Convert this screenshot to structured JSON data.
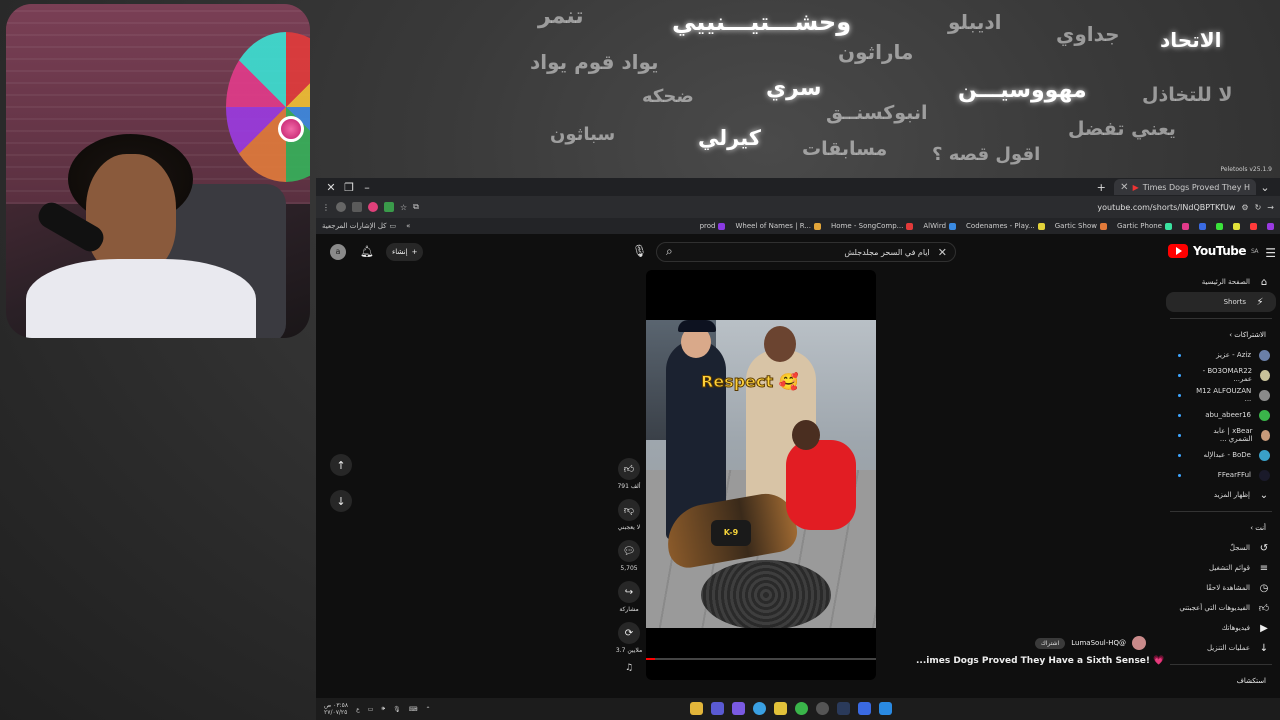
{
  "chalkboard": {
    "words": [
      {
        "text": "تنمر",
        "bright": false
      },
      {
        "text": "وحشـــتيـــنييي",
        "bright": true
      },
      {
        "text": "اديبلو",
        "bright": false
      },
      {
        "text": "جداوي",
        "bright": false
      },
      {
        "text": "الاتحاد",
        "bright": true
      },
      {
        "text": "يواد قوم يواد",
        "bright": false
      },
      {
        "text": "ماراثون",
        "bright": false
      },
      {
        "text": "سري",
        "bright": true
      },
      {
        "text": "ضحكه",
        "bright": false
      },
      {
        "text": "مهووسيـــن",
        "bright": true
      },
      {
        "text": "لا للتخاذل",
        "bright": false
      },
      {
        "text": "انبوكسنــق",
        "bright": false
      },
      {
        "text": "يعني تفضل",
        "bright": false
      },
      {
        "text": "سباثون",
        "bright": false
      },
      {
        "text": "كيرلي",
        "bright": true
      },
      {
        "text": "مسابقات",
        "bright": false
      },
      {
        "text": "اقول قصه ؟",
        "bright": false
      }
    ]
  },
  "browser": {
    "tab_title": "Times Dogs Proved They H",
    "url": "youtube.com/shorts/INdQBPTKfUw",
    "extension_label": "Peletools v25.1.9",
    "bookmarks": [
      "prod",
      "Wheel of Names | R...",
      "Home - SongComp...",
      "AlWird",
      "Codenames - Play...",
      "Gartic Show",
      "Gartic Phone"
    ],
    "bookmarks_all": "كل الإشارات المرجعية"
  },
  "youtube": {
    "logo_text": "YouTube",
    "logo_country": "SA",
    "search_query": "ايام في السحر مجلدجلش",
    "create_label": "إنشاء",
    "avatar_letter": "a",
    "sidebar": {
      "home": "الصفحة الرئيسية",
      "shorts": "Shorts",
      "subscriptions_header": "الاشتراكات",
      "subscriptions": [
        {
          "name": "Aziz - عزيز",
          "color": "#6a7fa8"
        },
        {
          "name": "BO3OMAR22 - عمر...",
          "color": "#c8c29a"
        },
        {
          "name": "M12 ALFOUZAN ...",
          "color": "#8a8a8a"
        },
        {
          "name": "abu_abeer16",
          "color": "#3ab54a"
        },
        {
          "name": "xBear | عابد الشمري ...",
          "color": "#c89a7a"
        },
        {
          "name": "BoDe - عبدالإله",
          "color": "#3aa0c8"
        },
        {
          "name": "FFearFFul",
          "color": "#1a1a2a"
        }
      ],
      "show_more": "إظهار المزيد",
      "you_header": "أنت",
      "you_items": [
        {
          "label": "السجلّ",
          "icon": "history-icon"
        },
        {
          "label": "قوائم التشغيل",
          "icon": "playlist-icon"
        },
        {
          "label": "المشاهدة لاحقًا",
          "icon": "clock-icon"
        },
        {
          "label": "الفيديوهات التي أعجبتني",
          "icon": "like-icon"
        },
        {
          "label": "فيديوهاتك",
          "icon": "video-icon"
        },
        {
          "label": "عمليات التنزيل",
          "icon": "download-icon"
        }
      ],
      "explore_header": "استكشاف"
    },
    "short": {
      "overlay_text": "Respect 🥰",
      "likes": "791 ألف",
      "dislike_label": "لا يعجبني",
      "comments": "5,705",
      "share_label": "مشاركة",
      "remix": "3.7 ملايين",
      "progress": 0.04,
      "channel": "@LumaSoul-HQ",
      "subscribe_label": "اشتراك",
      "title": "...imes Dogs Proved They Have a Sixth Sense! 💗"
    }
  },
  "taskbar": {
    "time": "٠٣:٥٨ ص",
    "date": "٢٧/٠٧/٢٥"
  }
}
